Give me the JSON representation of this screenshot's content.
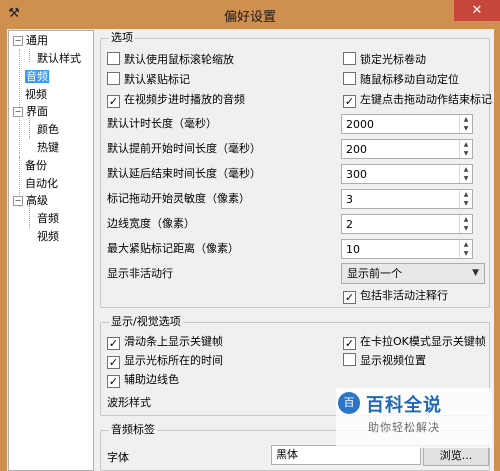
{
  "window": {
    "title": "偏好设置",
    "close_glyph": "✕",
    "app_icon": "hammer-icon",
    "accent": "#cf8f4f"
  },
  "sidebar": {
    "items": [
      {
        "label": "通用",
        "expander": "⊟"
      },
      {
        "label": "默认样式"
      },
      {
        "label": "音频"
      },
      {
        "label": "视频"
      },
      {
        "label": "界面",
        "expander": "⊟"
      },
      {
        "label": "颜色"
      },
      {
        "label": "热键"
      },
      {
        "label": "备份"
      },
      {
        "label": "自动化"
      },
      {
        "label": "高级",
        "expander": "⊟"
      },
      {
        "label": "音频"
      },
      {
        "label": "视频"
      }
    ],
    "selected": "音频"
  },
  "options": {
    "title": "选项",
    "checkboxes": [
      {
        "label": "默认使用鼠标滚轮缩放",
        "checked": false
      },
      {
        "label": "锁定光标卷动",
        "checked": false
      },
      {
        "label": "默认紧贴标记",
        "checked": false
      },
      {
        "label": "随鼠标移动自动定位",
        "checked": false
      },
      {
        "label": "在视频步进时播放的音频",
        "checked": true
      },
      {
        "label": "左键点击拖动动作结束标记",
        "checked": true
      }
    ],
    "fields": [
      {
        "label": "默认计时长度（毫秒）",
        "value": "2000"
      },
      {
        "label": "默认提前开始时间长度（毫秒）",
        "value": "200"
      },
      {
        "label": "默认延后结束时间长度（毫秒）",
        "value": "300"
      },
      {
        "label": "标记拖动开始灵敏度（像素）",
        "value": "3"
      },
      {
        "label": "边线宽度（像素）",
        "value": "2"
      },
      {
        "label": "最大紧贴标记距离（像素）",
        "value": "10"
      }
    ],
    "inactive": {
      "label": "显示非活动行",
      "value": "显示前一个"
    },
    "include_comments": {
      "label": "包括非活动注释行",
      "checked": true
    }
  },
  "display": {
    "title": "显示/视觉选项",
    "checkboxes": [
      {
        "label": "滑动条上显示关键帧",
        "checked": true
      },
      {
        "label": "在卡拉OK模式显示关键帧",
        "checked": true
      },
      {
        "label": "显示光标所在的时间",
        "checked": true
      },
      {
        "label": "显示视频位置",
        "checked": false
      },
      {
        "label": "辅助边线色",
        "checked": true
      }
    ],
    "waveform_label": "波形样式"
  },
  "audio_labels": {
    "title": "音频标签",
    "font_label": "字体",
    "font_value": "黑体",
    "browse_label": "浏览..."
  },
  "watermark": {
    "logo": "百",
    "title": "百科全说",
    "subtitle": "助你轻松解决"
  }
}
